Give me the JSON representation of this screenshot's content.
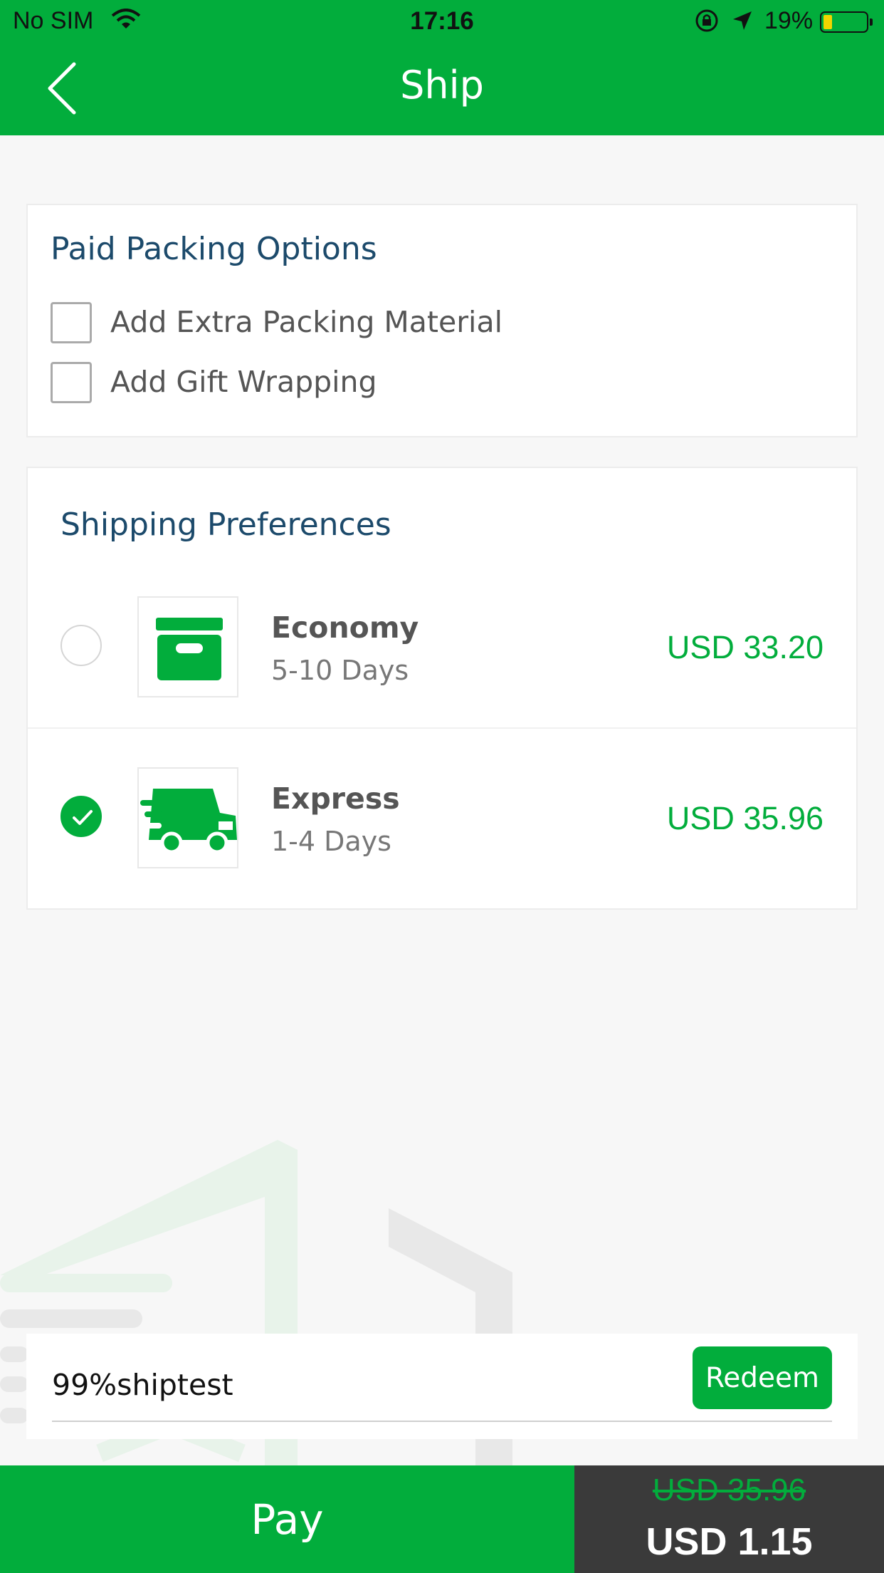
{
  "status_bar": {
    "carrier": "No SIM",
    "time": "17:16",
    "battery_percent": "19%",
    "battery_level": 0.19,
    "icons": [
      "wifi-icon",
      "rotation-lock-icon",
      "location-arrow-icon",
      "battery-icon"
    ]
  },
  "nav": {
    "title": "Ship",
    "back_icon": "chevron-left-icon"
  },
  "packing": {
    "title": "Paid Packing Options",
    "options": [
      {
        "label": "Add Extra Packing Material",
        "checked": false
      },
      {
        "label": "Add Gift Wrapping",
        "checked": false
      }
    ]
  },
  "shipping": {
    "title": "Shipping Preferences",
    "options": [
      {
        "name": "Economy",
        "days": "5-10 Days",
        "price": "USD 33.20",
        "icon": "box-icon",
        "selected": false
      },
      {
        "name": "Express",
        "days": "1-4 Days",
        "price": "USD 35.96",
        "icon": "fast-truck-icon",
        "selected": true
      }
    ]
  },
  "promo": {
    "code_value": "99%shiptest",
    "redeem_label": "Redeem"
  },
  "footer": {
    "pay_label": "Pay",
    "original_total": "USD 35.96",
    "discounted_total": "USD 1.15"
  },
  "colors": {
    "brand_green": "#02ad3c",
    "title_blue": "#1c4a6b",
    "total_bg": "#3a3a3a"
  }
}
